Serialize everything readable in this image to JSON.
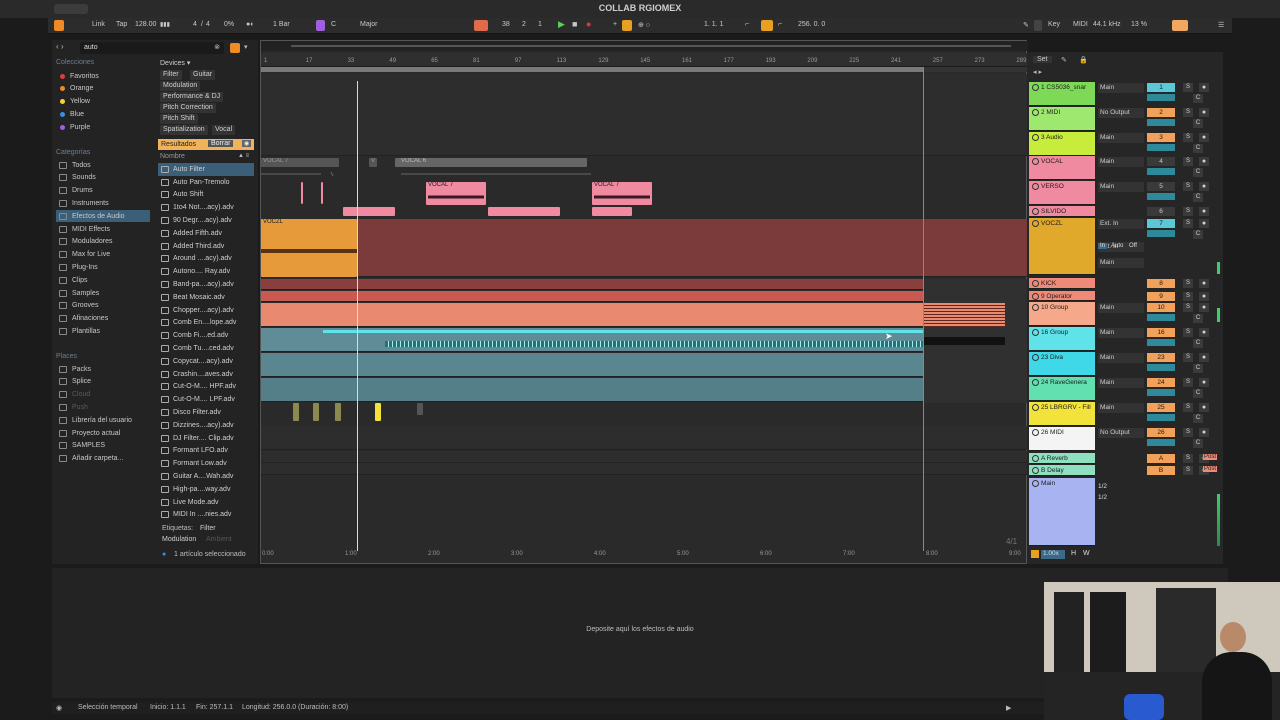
{
  "window": {
    "title": "COLLAB RGIOMEX"
  },
  "toolbar": {
    "link": "Link",
    "tap": "Tap",
    "tempo": "128.00",
    "meter_num": "4",
    "meter_den": "4",
    "cpu": "0%",
    "quantize": "1 Bar",
    "key_root": "C",
    "scale": "Major",
    "pos_bar": "38",
    "pos_beat": "2",
    "pos_sixteenth": "1",
    "loop_start": "1.  1.  1",
    "loop_len": "256.  0.  0",
    "key_label": "Key",
    "midi_label": "MIDI",
    "sample_rate": "44.1 kHz",
    "load": "13 %"
  },
  "browser": {
    "search_value": "auto",
    "collections_head": "Colecciones",
    "collections": [
      {
        "label": "Favoritos",
        "color": "#e23b3b"
      },
      {
        "label": "Orange",
        "color": "#f08a24"
      },
      {
        "label": "Yellow",
        "color": "#f2d23a"
      },
      {
        "label": "Blue",
        "color": "#3a8ee6"
      },
      {
        "label": "Purple",
        "color": "#a25ee0"
      }
    ],
    "categories_head": "Categorías",
    "categories": [
      "Todos",
      "Sounds",
      "Drums",
      "Instruments",
      "Efectos de Audio",
      "MIDI Effects",
      "Moduladores",
      "Max for Live",
      "Plug-Ins",
      "Clips",
      "Samples",
      "Grooves",
      "Afinaciones",
      "Plantillas"
    ],
    "places_head": "Places",
    "places": [
      "Packs",
      "Splice",
      "Cloud",
      "Push",
      "Librería del usuario",
      "Proyecto actual",
      "SAMPLES",
      "Añadir carpeta..."
    ],
    "devices_head": "Devices ▾",
    "device_tags": [
      "Filter",
      "Guitar",
      "Modulation",
      "Performance & DJ",
      "Pitch Correction",
      "Pitch Shift",
      "Spatialization",
      "Vocal"
    ],
    "results_label": "Resultados",
    "clear_label": "Borrar",
    "name_head": "Nombre",
    "results": [
      "Auto Filter",
      "Auto Pan-Tremolo",
      "Auto Shift",
      "1to4 Not....acy).adv",
      "90 Degr....acy).adv",
      "Added Fifth.adv",
      "Added Third.adv",
      "Around ....acy).adv",
      "Autono.... Ray.adv",
      "Band-pa....acy).adv",
      "Beat Mosaic.adv",
      "Chopper....acy).adv",
      "Comb En....lope.adv",
      "Comb Fi....ed.adv",
      "Comb Tu....ced.adv",
      "Copycat....acy).adv",
      "Crashin....aves.adv",
      "Cut-O-M.... HPF.adv",
      "Cut-O-M.... LPF.adv",
      "Disco Filter.adv",
      "Dizzines....acy).adv",
      "DJ Filter.... Clip.adv",
      "Formant LFO.adv",
      "Formant Low.adv",
      "Guitar A....Wah.adv",
      "High-pa....way.adv",
      "Live Mode.adv",
      "MIDI In ....nies.adv"
    ],
    "tags_label": "Etiquetas:",
    "tags_filter": "Filter",
    "tags_mod": "Modulation",
    "tags_amb": "Ambient",
    "selected_count": "1 artículo seleccionado"
  },
  "arrangement": {
    "ruler": [
      "1",
      "17",
      "33",
      "49",
      "65",
      "81",
      "97",
      "113",
      "129",
      "145",
      "161",
      "177",
      "193",
      "209",
      "225",
      "241",
      "257",
      "273",
      "289"
    ],
    "times": [
      "0:00",
      "1:00",
      "2:00",
      "3:00",
      "4:00",
      "5:00",
      "6:00",
      "7:00",
      "8:00",
      "9:00"
    ],
    "clips": {
      "vocal7a": "VOCAL 7",
      "vv": "V",
      "vocal6": "VOCAL 6",
      "vocal7b": "VOCAL 7",
      "vocal7c": "VOCAL 7",
      "voczl": "VOCZL"
    },
    "page_indicator": "4/1"
  },
  "mixer": {
    "set_label": "Set",
    "tracks": [
      {
        "name": "1 CS5036_snar",
        "color": "#7ed957",
        "route": "Main",
        "num": "1",
        "numcolor": "#5bc8d8"
      },
      {
        "name": "2 MIDI",
        "color": "#9fe870",
        "route": "No Output",
        "num": "2",
        "numcolor": "#f2a15a"
      },
      {
        "name": "3 Audio",
        "color": "#c8ec3c",
        "route": "Main",
        "num": "3",
        "numcolor": "#f2a15a"
      },
      {
        "name": "VOCAL",
        "color": "#f08aa0",
        "route": "Main",
        "num": "4",
        "numcolor": "#3a3a3a"
      },
      {
        "name": "VERSO",
        "color": "#f08aa0",
        "route": "Main",
        "num": "5",
        "numcolor": "#3a3a3a"
      },
      {
        "name": "SILVIDO",
        "color": "#f08aa0",
        "route": "",
        "num": "6",
        "numcolor": "#3a3a3a"
      },
      {
        "name": "VOCZL",
        "color": "#e0a92c",
        "route": "Ext. In",
        "num": "7",
        "numcolor": "#5bc8d8"
      },
      {
        "name": "KICK",
        "color": "#f08a78",
        "route": "",
        "num": "8",
        "numcolor": "#f2a15a"
      },
      {
        "name": "9 Operator",
        "color": "#f08a78",
        "route": "",
        "num": "9",
        "numcolor": "#f2a15a"
      },
      {
        "name": "10 Group",
        "color": "#f6a98a",
        "route": "Main",
        "num": "10",
        "numcolor": "#f2a15a"
      },
      {
        "name": "16 Group",
        "color": "#5fe3e8",
        "route": "Main",
        "num": "16",
        "numcolor": "#f2a15a"
      },
      {
        "name": "23 Diva",
        "color": "#3fd8e8",
        "route": "Main",
        "num": "23",
        "numcolor": "#f2a15a"
      },
      {
        "name": "24 RaveGenera",
        "color": "#62e0b0",
        "route": "Main",
        "num": "24",
        "numcolor": "#f2a15a"
      },
      {
        "name": "25 LBRGRV - Fill",
        "color": "#f2e33c",
        "route": "Main",
        "num": "25",
        "numcolor": "#f2a15a"
      },
      {
        "name": "26 MIDI",
        "color": "#f4f4f4",
        "route": "No Output",
        "num": "26",
        "numcolor": "#f2a15a"
      },
      {
        "name": "A Reverb",
        "color": "#8fe0c0",
        "route": "",
        "num": "A",
        "numcolor": "#f2a15a"
      },
      {
        "name": "B Delay",
        "color": "#8fe0c0",
        "route": "",
        "num": "B",
        "numcolor": "#f2a15a"
      },
      {
        "name": "Main",
        "color": "#a8b4f2",
        "route": "",
        "num": "",
        "numcolor": "#3a3a3a"
      }
    ],
    "ext_in": "Ext. In",
    "in_label": "In",
    "auto_label": "Auto",
    "off_label": "Off",
    "main_route": "Main",
    "half_a": "1/2",
    "half_b": "1/2",
    "post": "Post",
    "zoom": "1.00x",
    "h_label": "H",
    "w_label": "W"
  },
  "detail": {
    "drop_text": "Deposite aquí los efectos de audio"
  },
  "status": {
    "mode": "Selección temporal",
    "start": "Inicio: 1.1.1",
    "end": "Fin: 257.1.1",
    "length": "Longitud: 256.0.0 (Duración: 8:00)"
  },
  "colors": {
    "vocal_pink": "#f08aa0",
    "voczl_lane": "#7c3b3b",
    "voczl_clip": "#e79a3a",
    "group_salmon": "#e9896f",
    "teal": "#5f8c97"
  }
}
